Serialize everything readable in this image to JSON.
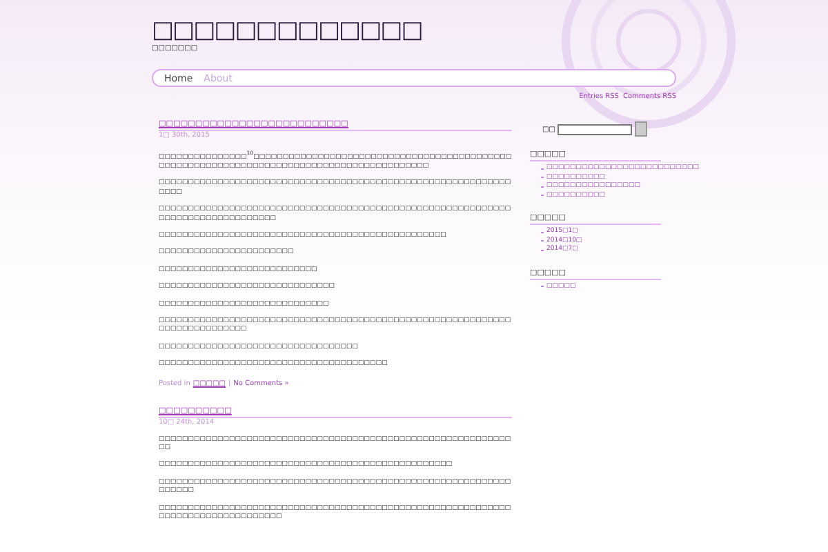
{
  "site": {
    "title": "□□□□□□□□□□□□□",
    "tagline": "□□□□□□□"
  },
  "nav": [
    {
      "label": "Home",
      "selected": true
    },
    {
      "label": "About",
      "selected": false
    }
  ],
  "feeds": [
    "Entries RSS",
    "Comments RSS"
  ],
  "posts": [
    {
      "title": "□□□□□□□□□□□□□□□□□□□□□□□□□□",
      "date": "1□ 30th, 2015",
      "paragraphs": [
        "□□□□□□□□□□□□□□□$^{10}$□□□□□□□□□□□□□□□□□□□□□□□□□□□□□□□□□□□□□□□□□□□□□□□□□□□□□□□□□□□□□□□□□□□□□□□□□□□□□□□□□□□□□□□□□□",
        "□□□□□□□□□□□□□□□□□□□□□□□□□□□□□□□□□□□□□□□□□□□□□□□□□□□□□□□□□□□□□□□□",
        "□□□□□□□□□□□□□□□□□□□□□□□□□□□□□□□□□□□□□□□□□□□□□□□□□□□□□□□□□□□□□□□□□□□□□□□□□□□□□□□□",
        "□□□□□□□□□□□□□□□□□□□□□□□□□□□□□□□□□□□□□□□□□□□□□□□□□",
        "□□□□□□□□□□□□□□□□□□□□□□□",
        "□□□□□□□□□□□□□□□□□□□□□□□□□□□",
        "□□□□□□□□□□□□□□□□□□□□□□□□□□□□□□",
        "□□□□□□□□□□□□□□□□□□□□□□□□□□□□□",
        "□□□□□□□□□□□□□□□□□□□□□□□□□□□□□□□□□□□□□□□□□□□□□□□□□□□□□□□□□□□□□□□□□□□□□□□□□□□",
        "□□□□□□□□□□□□□□□□□□□□□□□□□□□□□□□□□□",
        "□□□□□□□□□□□□□□□□□□□□□□□□□□□□□□□□□□□□□□□"
      ],
      "posted_in": "Posted in",
      "category": "□□□□□",
      "separator": "|",
      "comments": "No Comments »"
    },
    {
      "title": "□□□□□□□□□□",
      "date": "10□ 24th, 2014",
      "paragraphs": [
        "□□□□□□□□□□□□□□□□□□□□□□□□□□□□□□□□□□□□□□□□□□□□□□□□□□□□□□□□□□□□□□",
        "□□□□□□□□□□□□□□□□□□□□□□□□□□□□□□□□□□□□□□□□□□□□□□□□□□",
        "□□□□□□□□□□□□□□□□□□□□□□□□□□□□□□□□□□□□□□□□□□□□□□□□□□□□□□□□□□□□□□□□□□",
        "□□□□□□□□□□□□□□□□□□□□□□□□□□□□□□□□□□□□□□□□□□□□□□□□□□□□□□□□□□□□□□□□□□□□□□□□□□□□□□□□□"
      ]
    }
  ],
  "sidebar": {
    "search": {
      "label": "□□"
    },
    "widgets": [
      {
        "heading": "□□□□□",
        "items": [
          "□□□□□□□□□□□□□□□□□□□□□□□□□□",
          "□□□□□□□□□□",
          "□□□□□□□□□□□□□□□□",
          "□□□□□□□□□□"
        ]
      },
      {
        "heading": "□□□□□",
        "items": [
          "2015□1□",
          "2014□10□",
          "2014□7□"
        ]
      },
      {
        "heading": "□□□□□",
        "items": [
          "□□□□□"
        ]
      }
    ]
  }
}
